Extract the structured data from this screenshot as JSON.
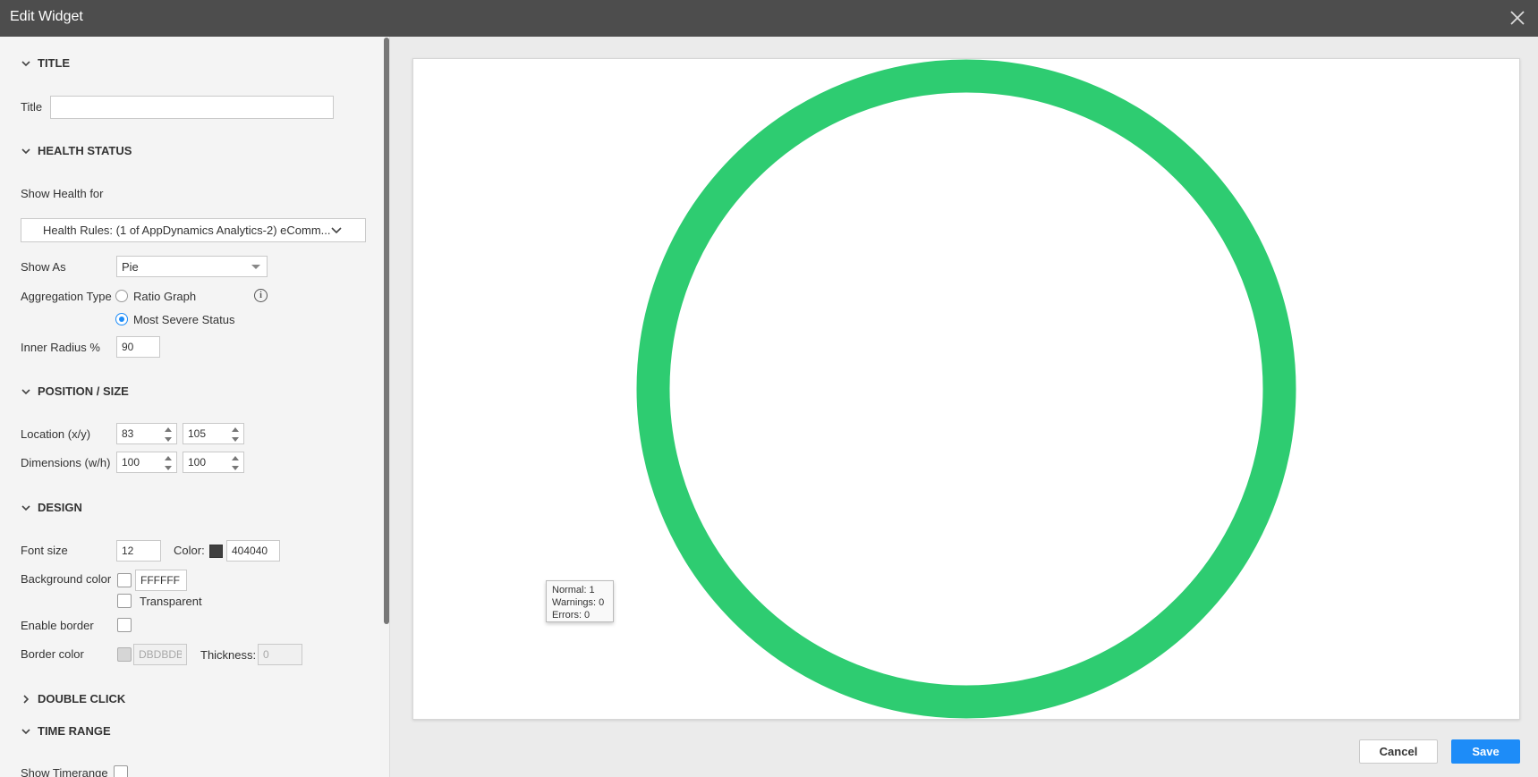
{
  "window": {
    "title": "Edit Widget"
  },
  "sections": {
    "title": "TITLE",
    "health_status": "HEALTH STATUS",
    "position_size": "POSITION / SIZE",
    "design": "DESIGN",
    "double_click": "DOUBLE CLICK",
    "time_range": "TIME RANGE"
  },
  "title_field": {
    "label": "Title",
    "value": ""
  },
  "health": {
    "show_health_for_label": "Show Health for",
    "show_health_for_value": "Health Rules: (1 of AppDynamics Analytics-2) eComm...",
    "show_as_label": "Show As",
    "show_as_value": "Pie",
    "aggregation_label": "Aggregation Type",
    "aggregation_options": [
      "Ratio Graph",
      "Most Severe Status"
    ],
    "aggregation_selected": "Most Severe Status",
    "inner_radius_label": "Inner Radius %",
    "inner_radius_value": "90"
  },
  "position": {
    "location_label": "Location (x/y)",
    "location_x": "83",
    "location_y": "105",
    "dimensions_label": "Dimensions (w/h)",
    "width": "100",
    "height": "100"
  },
  "design": {
    "font_size_label": "Font size",
    "font_size_value": "12",
    "color_label": "Color:",
    "color_value": "404040",
    "bg_color_label": "Background color",
    "bg_color_value": "FFFFFF",
    "transparent_label": "Transparent",
    "enable_border_label": "Enable border",
    "border_color_label": "Border color",
    "border_color_value": "DBDBDB",
    "thickness_label": "Thickness:",
    "thickness_value": "0"
  },
  "time_range": {
    "show_timerange_label": "Show Timerange"
  },
  "preview": {
    "ring_color": "#2ecc71",
    "tooltip": {
      "normal": "Normal: 1",
      "warnings": "Warnings: 0",
      "errors": "Errors: 0"
    }
  },
  "colors": {
    "accent": "#1d8cf8",
    "titlebar": "#4d4d4d",
    "font_color": "#404040"
  },
  "buttons": {
    "cancel": "Cancel",
    "save": "Save"
  }
}
